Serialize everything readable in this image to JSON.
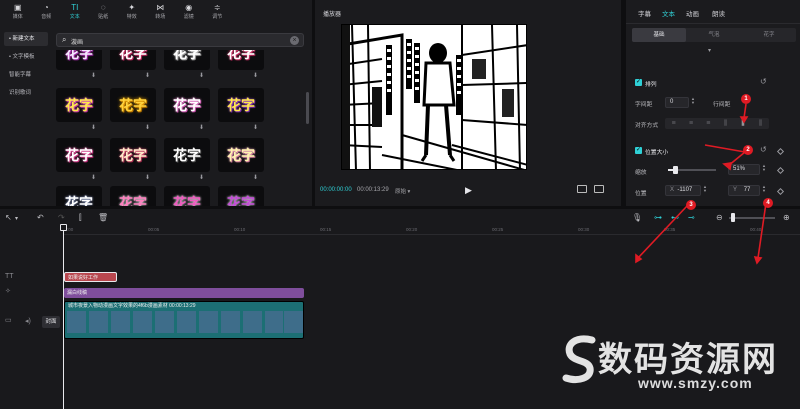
{
  "top_tabs": [
    {
      "label": "媒体",
      "icon": "media-icon"
    },
    {
      "label": "音频",
      "icon": "audio-icon"
    },
    {
      "label": "文本",
      "icon": "text-icon",
      "active": true
    },
    {
      "label": "贴纸",
      "icon": "sticker-icon"
    },
    {
      "label": "特效",
      "icon": "effects-icon"
    },
    {
      "label": "转场",
      "icon": "transition-icon"
    },
    {
      "label": "滤镜",
      "icon": "filter-icon"
    },
    {
      "label": "调节",
      "icon": "adjust-icon"
    }
  ],
  "sidebar": {
    "items": [
      {
        "label": "• 新建文本",
        "active": true
      },
      {
        "label": "• 文字模板"
      },
      {
        "label": "智能字幕"
      },
      {
        "label": "识别歌词"
      }
    ]
  },
  "search": {
    "query": "漩画"
  },
  "templates": {
    "tile_text": "花字",
    "download_glyph": "⬇"
  },
  "player": {
    "title": "播放器",
    "time_current": "00:00:00:00",
    "time_total": "00:00:13:29",
    "ratio": "原始 ▾",
    "play_glyph": "▶"
  },
  "inspector": {
    "tabs": [
      "字幕",
      "文本",
      "动画",
      "朗读"
    ],
    "active_tab": "文本",
    "subtabs": [
      "基础",
      "气泡",
      "花字"
    ],
    "active_subtab": "基础",
    "arrange": {
      "section_label": "排列",
      "char_spacing_label": "字间距",
      "char_spacing_value": "0",
      "line_spacing_label": "行间距",
      "align_label": "对齐方式"
    },
    "position": {
      "section_label": "位置大小",
      "scale_label": "缩放",
      "scale_value": "51%",
      "scale_fraction": 0.51,
      "pos_label": "位置",
      "x_prefix": "X",
      "x_value": "-1107",
      "y_prefix": "Y",
      "y_value": "77"
    }
  },
  "annotations": [
    "1",
    "2",
    "3",
    "4"
  ],
  "timeline": {
    "ticks": [
      "00:00",
      "00:05",
      "00:10",
      "00:15",
      "00:20",
      "00:25",
      "00:30",
      "00:35",
      "00:40"
    ],
    "text_clip": "如果说好工作",
    "effect_clip": "漏白线稿",
    "video_clip": "城市夜景入物动漫画文字效果的4f6b漫画素材  00:00:13:29",
    "cover_label": "封面"
  },
  "watermark": {
    "text": "数码资源网",
    "url": "www.smzy.com"
  },
  "colors": {
    "accent": "#2fd0d6",
    "annotation": "#e01b24",
    "text_clip": "#b9474f",
    "effect_clip": "#7f4e9c",
    "video_clip": "#1c6f74"
  }
}
